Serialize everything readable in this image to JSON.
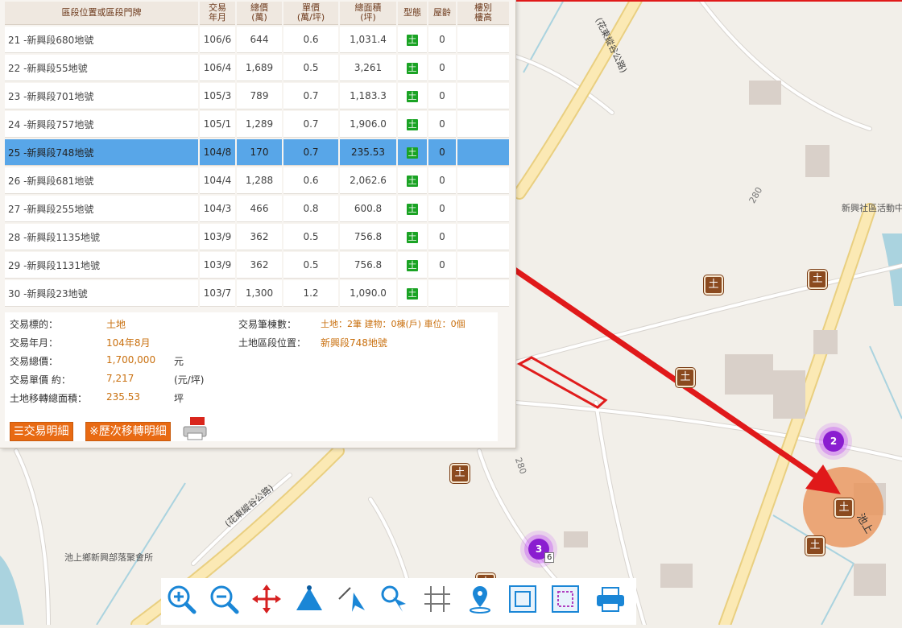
{
  "table": {
    "headers": {
      "location": "區段位置或區段門牌",
      "date_1": "交易",
      "date_2": "年月",
      "total_1": "總價",
      "total_2": "(萬)",
      "unit_1": "單價",
      "unit_2": "(萬/坪)",
      "area_1": "總面積",
      "area_2": "(坪)",
      "type": "型態",
      "age": "屋齡",
      "floor_1": "樓別",
      "floor_2": "樓高"
    },
    "rows": [
      {
        "location": "21 -新興段680地號",
        "date": "106/6",
        "total": "644",
        "unit": "0.6",
        "area": "1,031.4",
        "type": "土",
        "age": "0"
      },
      {
        "location": "22 -新興段55地號",
        "date": "106/4",
        "total": "1,689",
        "unit": "0.5",
        "area": "3,261",
        "type": "土",
        "age": "0"
      },
      {
        "location": "23 -新興段701地號",
        "date": "105/3",
        "total": "789",
        "unit": "0.7",
        "area": "1,183.3",
        "type": "土",
        "age": "0"
      },
      {
        "location": "24 -新興段757地號",
        "date": "105/1",
        "total": "1,289",
        "unit": "0.7",
        "area": "1,906.0",
        "type": "土",
        "age": "0"
      },
      {
        "location": "25 -新興段748地號",
        "date": "104/8",
        "total": "170",
        "unit": "0.7",
        "area": "235.53",
        "type": "土",
        "age": "0"
      },
      {
        "location": "26 -新興段681地號",
        "date": "104/4",
        "total": "1,288",
        "unit": "0.6",
        "area": "2,062.6",
        "type": "土",
        "age": "0"
      },
      {
        "location": "27 -新興段255地號",
        "date": "104/3",
        "total": "466",
        "unit": "0.8",
        "area": "600.8",
        "type": "土",
        "age": "0"
      },
      {
        "location": "28 -新興段1135地號",
        "date": "103/9",
        "total": "362",
        "unit": "0.5",
        "area": "756.8",
        "type": "土",
        "age": "0"
      },
      {
        "location": "29 -新興段1131地號",
        "date": "103/9",
        "total": "362",
        "unit": "0.5",
        "area": "756.8",
        "type": "土",
        "age": "0"
      },
      {
        "location": "30 -新興段23地號",
        "date": "103/7",
        "total": "1,300",
        "unit": "1.2",
        "area": "1,090.0",
        "type": "土",
        "age": ""
      }
    ]
  },
  "detail": {
    "target_label": "交易標的：",
    "target_value": "土地",
    "date_label": "交易年月：",
    "date_value": "104年8月",
    "total_label": "交易總價：",
    "total_value": "1,700,000",
    "total_unit": "元",
    "unit_label": "交易單價 約：",
    "unit_value": "7,217",
    "unit_unit": "(元/坪)",
    "area_label": "土地移轉總面積：",
    "area_value": "235.53",
    "area_unit": "坪",
    "count_label": "交易筆棟數：",
    "count_value": "土地：2筆 建物：0棟(戶) 車位：0個",
    "section_label": "土地區段位置：",
    "section_value": "新興段748地號"
  },
  "buttons": {
    "detail": "交易明細",
    "history": "※歷次移轉明細"
  },
  "map": {
    "road_label": "(花東縱谷公路)",
    "route_number": "280",
    "poi_glyph": "土",
    "place_community_center": "新興社區活動中",
    "place_assembly_hall": "池上鄉新興部落聚會所",
    "road_chishang": "池上",
    "cluster_2": "2",
    "cluster_3": "3",
    "road_shield": "6"
  },
  "colors": {
    "accent": "#e86a13",
    "selected_row": "#58a6e8",
    "land_icon": "#1aa324",
    "arrow": "#e0191a",
    "cluster": "#8a1dd0",
    "poi": "#8b4a1f"
  },
  "toolbar_icons": [
    "zoom-in-icon",
    "zoom-out-icon",
    "pan-icon",
    "measure-area-icon",
    "select-icon",
    "identify-icon",
    "parcel-icon",
    "location-pin-icon",
    "frame-icon",
    "frame-dashed-icon",
    "printer-icon"
  ]
}
